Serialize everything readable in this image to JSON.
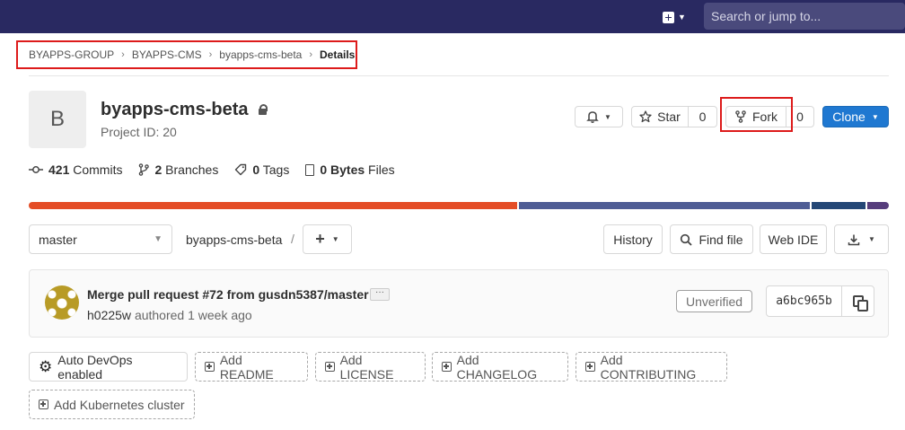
{
  "topbar": {
    "search_placeholder": "Search or jump to...",
    "plus_icon": "plus-square-icon"
  },
  "breadcrumb": {
    "items": [
      "BYAPPS-GROUP",
      "BYAPPS-CMS",
      "byapps-cms-beta",
      "Details"
    ]
  },
  "project": {
    "avatar_letter": "B",
    "title": "byapps-cms-beta",
    "id_text": "Project ID: 20",
    "visibility_icon": "lock-icon"
  },
  "actions": {
    "star_label": "Star",
    "star_count": "0",
    "fork_label": "Fork",
    "fork_count": "0",
    "clone_label": "Clone"
  },
  "stats": {
    "commits_count": "421",
    "commits_label": "Commits",
    "branches_count": "2",
    "branches_label": "Branches",
    "tags_count": "0",
    "tags_label": "Tags",
    "files_size": "0 Bytes",
    "files_label": "Files"
  },
  "languages": {
    "colors": [
      "#e44d26",
      "#4f5d95",
      "#244776",
      "#563d7c"
    ],
    "fractions": [
      0.57,
      0.34,
      0.065,
      0.025
    ]
  },
  "repo": {
    "branch": "master",
    "path": "byapps-cms-beta",
    "path_sep": "/",
    "history_label": "History",
    "find_file_label": "Find file",
    "web_ide_label": "Web IDE"
  },
  "commit": {
    "title": "Merge pull request #72 from gusdn5387/master",
    "author": "h0225w",
    "authored_text": "authored 1 week ago",
    "verification": "Unverified",
    "sha": "a6bc965b"
  },
  "quick_actions": {
    "auto_devops": "Auto DevOps enabled",
    "readme": "Add README",
    "license": "Add LICENSE",
    "changelog": "Add CHANGELOG",
    "contributing": "Add CONTRIBUTING",
    "kubernetes": "Add Kubernetes cluster"
  },
  "colors": {
    "topbar": "#292961",
    "primary": "#1f78d1",
    "highlight": "#dd1b1b"
  }
}
